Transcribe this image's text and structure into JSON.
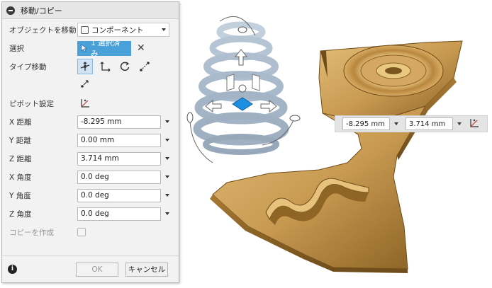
{
  "dialog": {
    "title": "移動/コピー",
    "object_move": {
      "label": "オブジェクトを移動",
      "value": "コンポーネント"
    },
    "selection": {
      "label": "選択",
      "chip": "1 選択済み"
    },
    "move_type": {
      "label": "タイプ移動"
    },
    "pivot": {
      "label": "ピボット設定"
    },
    "fields": [
      {
        "label": "X 距離",
        "value": "-8.295 mm"
      },
      {
        "label": "Y 距離",
        "value": "0.00 mm"
      },
      {
        "label": "Z 距離",
        "value": "3.714 mm"
      },
      {
        "label": "X 角度",
        "value": "0.0 deg"
      },
      {
        "label": "Y 角度",
        "value": "0.0 deg"
      },
      {
        "label": "Z 角度",
        "value": "0.0 deg"
      }
    ],
    "create_copy": {
      "label": "コピーを作成",
      "checked": false
    },
    "buttons": {
      "ok": "OK",
      "cancel": "キャンセル"
    }
  },
  "viewport": {
    "value_bar": {
      "x_value": "-8.295 mm",
      "z_value": "3.714 mm"
    }
  },
  "colors": {
    "accent": "#4aa0d8",
    "gizmo_handle": "#1e8fe0",
    "part_body": "#c99b52",
    "spring": "#9eb2c6"
  }
}
